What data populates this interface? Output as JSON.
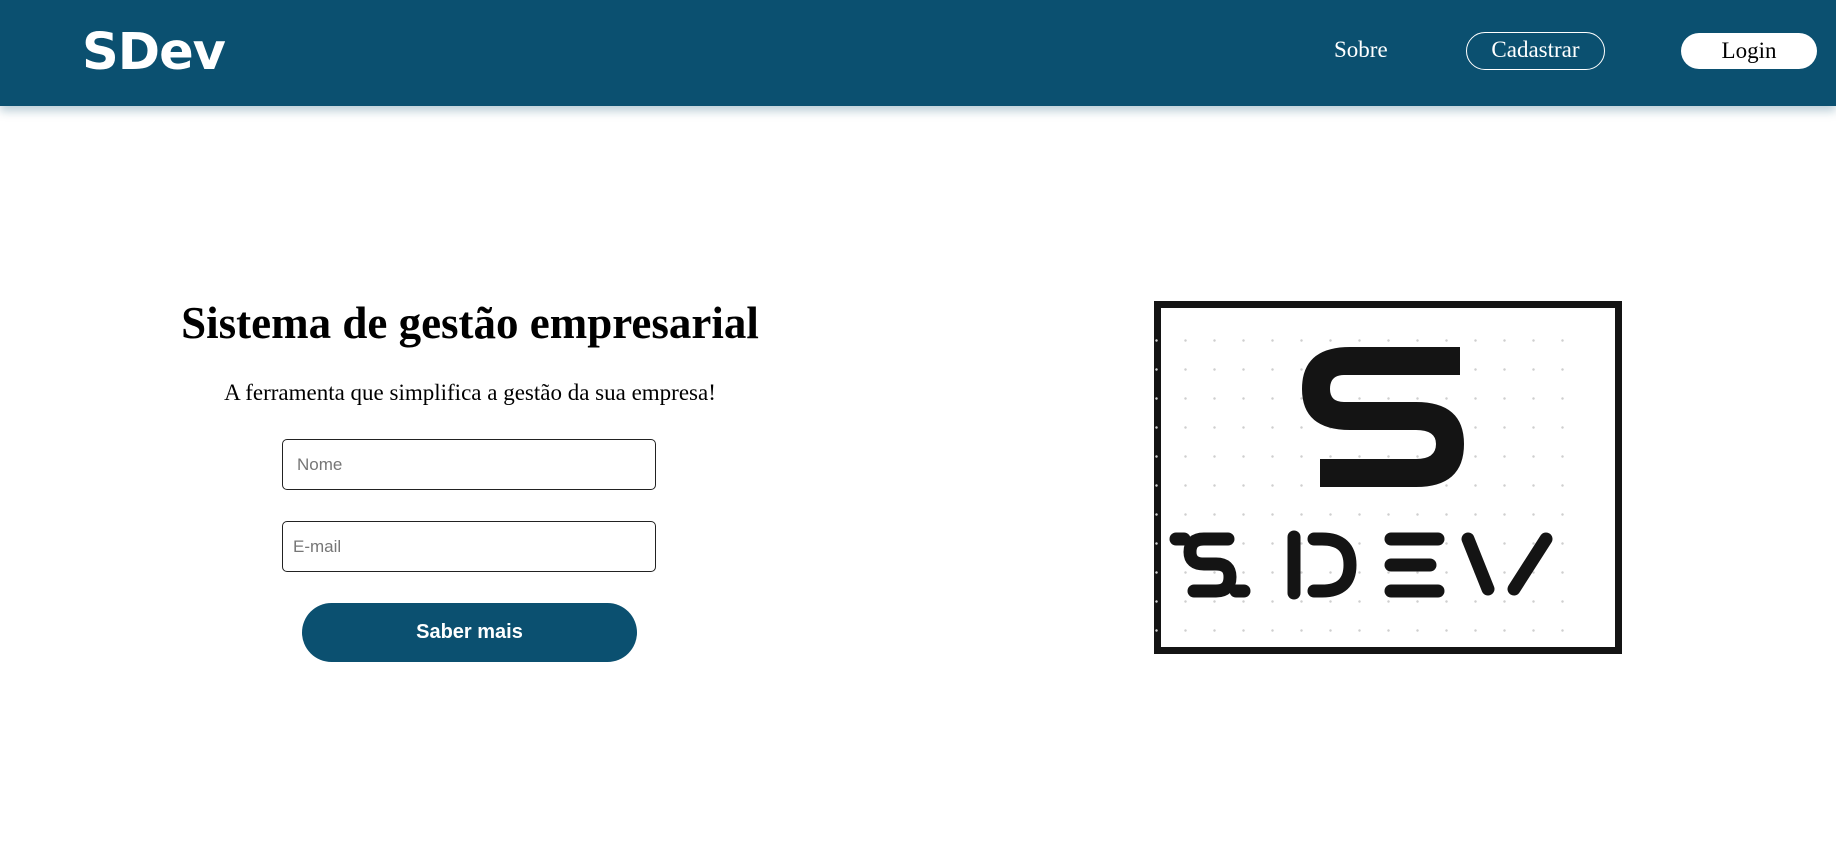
{
  "header": {
    "brand": "SDev",
    "nav": {
      "about_label": "Sobre",
      "register_label": "Cadastrar",
      "login_label": "Login"
    },
    "colors": {
      "primary": "#0b5070",
      "on_primary": "#ffffff"
    }
  },
  "hero": {
    "title": "Sistema de gestão empresarial",
    "subtitle": "A ferramenta que simplifica a gestão da sua empresa!",
    "form": {
      "name_placeholder": "Nome",
      "email_placeholder": "E-mail",
      "name_value": "",
      "email_value": "",
      "submit_label": "Saber mais"
    }
  },
  "logo": {
    "icon": "sdev-logo-icon",
    "letter_mark": "S",
    "wordmark": "SDEV",
    "color": "#141414"
  }
}
